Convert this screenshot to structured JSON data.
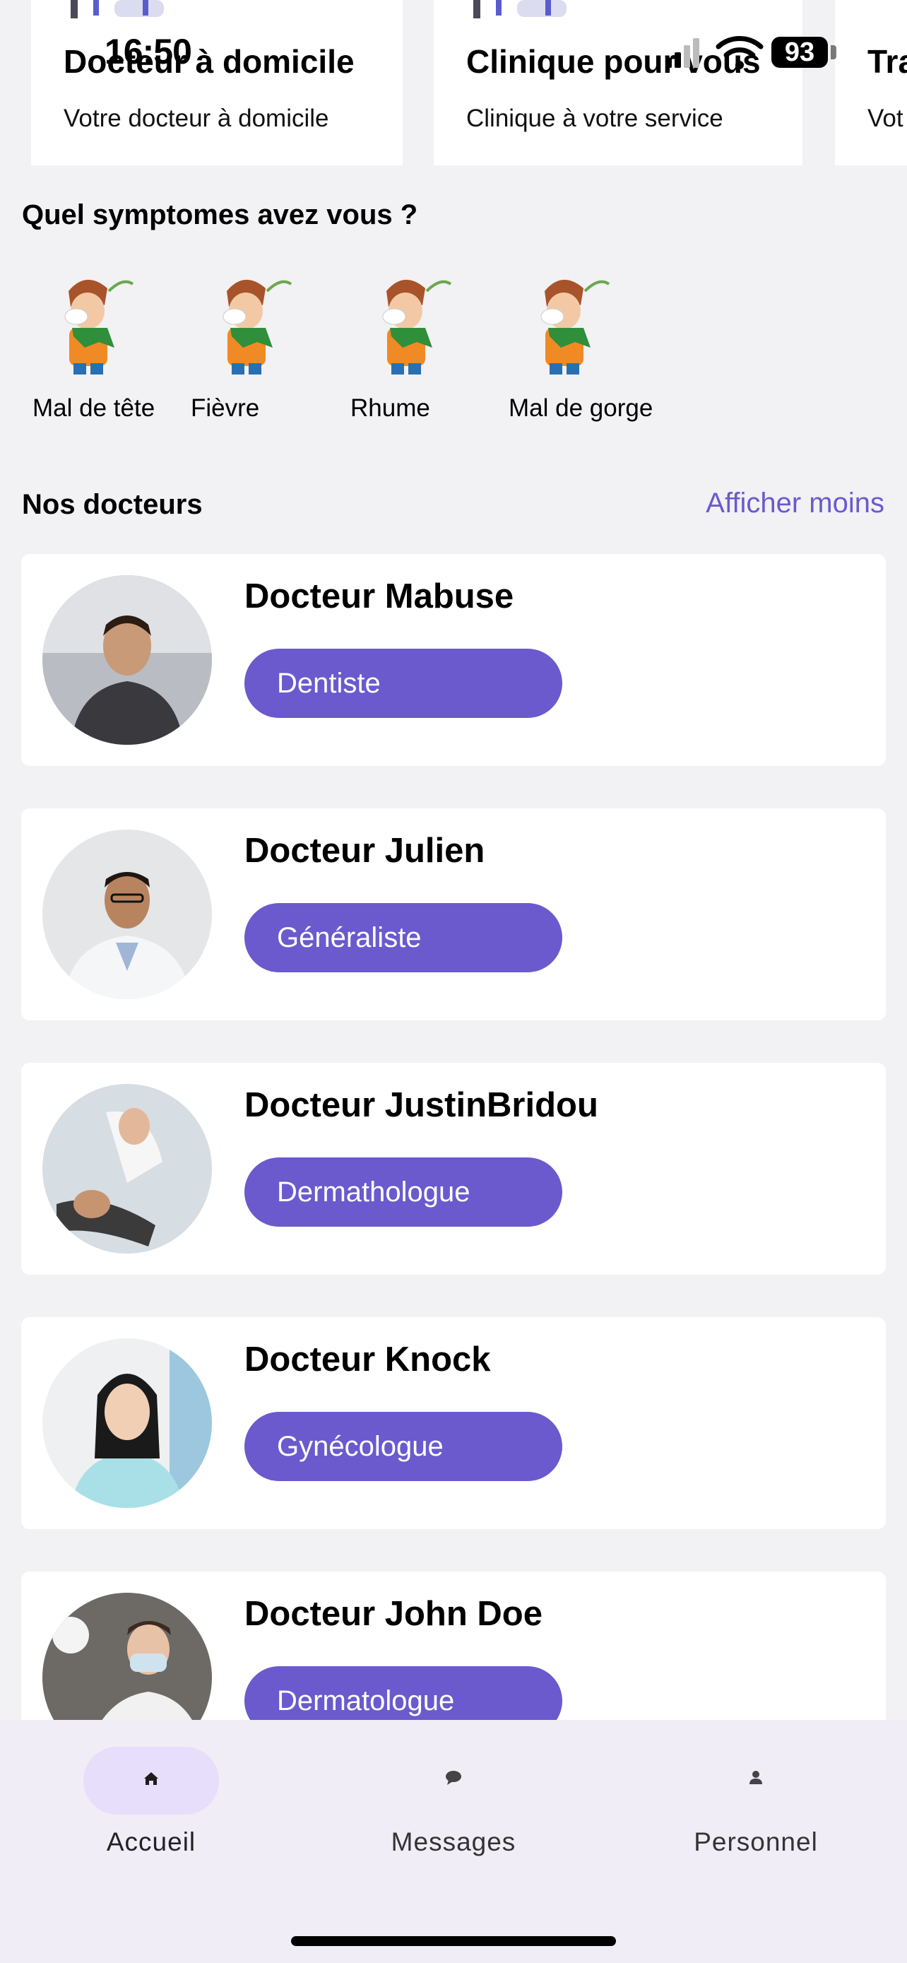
{
  "status_bar": {
    "time": "16:50",
    "battery": "93"
  },
  "service_cards": [
    {
      "title": "Docteur à domicile",
      "subtitle": "Votre docteur à domicile"
    },
    {
      "title": "Clinique pour vous",
      "subtitle": "Clinique à votre service"
    },
    {
      "title": "Tra",
      "subtitle": "Vot"
    }
  ],
  "symptoms": {
    "title": "Quel symptomes avez vous ?",
    "items": [
      {
        "label": "Mal de tête"
      },
      {
        "label": "Fièvre"
      },
      {
        "label": "Rhume"
      },
      {
        "label": "Mal de gorge"
      }
    ]
  },
  "doctors": {
    "title": "Nos docteurs",
    "toggle_label": "Afficher moins",
    "items": [
      {
        "name": "Docteur Mabuse",
        "specialty": "Dentiste"
      },
      {
        "name": "Docteur Julien",
        "specialty": "Généraliste"
      },
      {
        "name": "Docteur JustinBridou",
        "specialty": "Dermathologue"
      },
      {
        "name": "Docteur Knock",
        "specialty": "Gynécologue"
      },
      {
        "name": "Docteur John Doe",
        "specialty": "Dermatologue"
      }
    ]
  },
  "bottom_nav": {
    "items": [
      {
        "label": "Accueil",
        "icon": "home-icon",
        "active": true
      },
      {
        "label": "Messages",
        "icon": "chat-bubble-icon",
        "active": false
      },
      {
        "label": "Personnel",
        "icon": "person-icon",
        "active": false
      }
    ]
  },
  "colors": {
    "accent": "#6a5acd",
    "background": "#f2f1f3",
    "nav_background": "#f0edf6",
    "active_pill": "#e6defa"
  }
}
